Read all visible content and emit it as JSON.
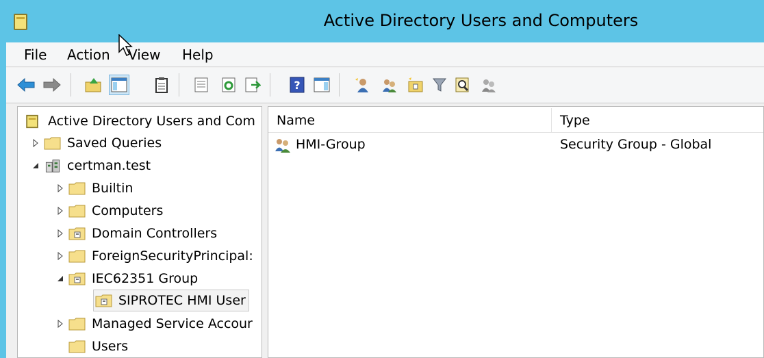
{
  "window": {
    "title": "Active Directory Users and Computers"
  },
  "menu": {
    "items": [
      "File",
      "Action",
      "View",
      "Help"
    ]
  },
  "toolbar": {
    "buttons": [
      "back-arrow-icon",
      "forward-arrow-icon",
      "up-folder-icon",
      "show-console-tree-icon",
      "clipboard-icon",
      "properties-icon",
      "refresh-icon",
      "export-list-icon",
      "help-icon",
      "show-action-pane-icon",
      "new-user-icon",
      "new-group-icon",
      "new-ou-icon",
      "filter-icon",
      "find-icon",
      "add-to-group-icon"
    ]
  },
  "tree": {
    "root": "Active Directory Users and Com",
    "items": [
      {
        "label": "Saved Queries",
        "expander": "collapsed"
      },
      {
        "label": "certman.test",
        "expander": "expanded"
      },
      {
        "label": "Builtin",
        "expander": "collapsed"
      },
      {
        "label": "Computers",
        "expander": "collapsed"
      },
      {
        "label": "Domain Controllers",
        "expander": "collapsed"
      },
      {
        "label": "ForeignSecurityPrincipal:",
        "expander": "collapsed"
      },
      {
        "label": "IEC62351 Group",
        "expander": "expanded"
      },
      {
        "label": "SIPROTEC HMI User",
        "expander": "none",
        "selected": true
      },
      {
        "label": "Managed Service Accour",
        "expander": "collapsed"
      },
      {
        "label": "Users",
        "expander": "none"
      }
    ]
  },
  "list": {
    "columns": [
      "Name",
      "Type"
    ],
    "rows": [
      {
        "name": "HMI-Group",
        "type": "Security Group - Global"
      }
    ]
  },
  "colors": {
    "titlebar": "#5dc4e6",
    "folder": "#f6df8c",
    "selection": "#cde6f7"
  }
}
